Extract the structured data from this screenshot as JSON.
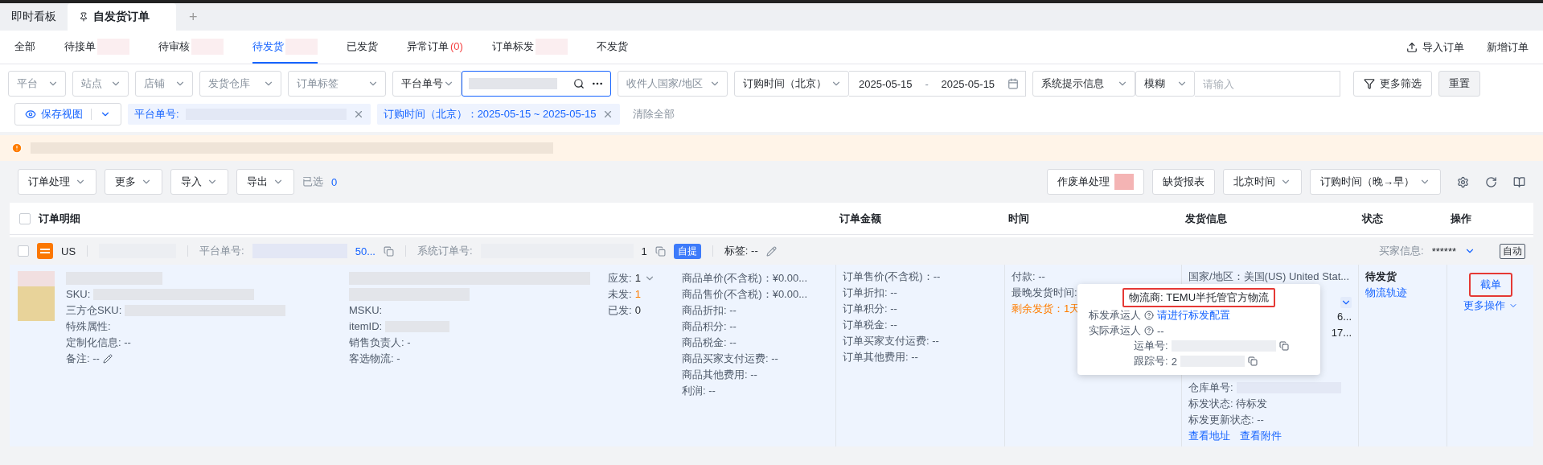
{
  "app_tabs": [
    {
      "label": "即时看板",
      "selected": false,
      "pinned": false
    },
    {
      "label": "自发货订单",
      "selected": true,
      "pinned": true
    }
  ],
  "add_tab": "+",
  "status_tabs": [
    {
      "label": "全部",
      "selected": false,
      "redacted": false
    },
    {
      "label": "待接单",
      "selected": false,
      "redacted": true
    },
    {
      "label": "待审核",
      "selected": false,
      "redacted": true
    },
    {
      "label": "待发货",
      "selected": true,
      "redacted": true
    },
    {
      "label": "已发货",
      "selected": false,
      "redacted": false
    },
    {
      "label": "异常订单",
      "count": "(0)",
      "selected": false,
      "redacted": false
    },
    {
      "label": "订单标发",
      "selected": false,
      "redacted": true
    },
    {
      "label": "不发货",
      "selected": false,
      "redacted": false
    }
  ],
  "header_actions": [
    {
      "kind": "import",
      "label": "导入订单"
    },
    {
      "kind": "plain",
      "label": "新增订单"
    }
  ],
  "filters": [
    {
      "kind": "select",
      "placeholder": "平台"
    },
    {
      "kind": "select",
      "placeholder": "站点"
    },
    {
      "kind": "select",
      "placeholder": "店铺"
    },
    {
      "kind": "select",
      "placeholder": "发货仓库"
    },
    {
      "kind": "select",
      "placeholder": "订单标签"
    },
    {
      "kind": "select",
      "value": "平台单号"
    },
    {
      "kind": "search",
      "redacted": true
    },
    {
      "kind": "select",
      "placeholder": "收件人国家/地区"
    },
    {
      "kind": "select",
      "value": "订购时间（北京）"
    },
    {
      "kind": "daterange",
      "start": "2025-05-15",
      "separator": "-",
      "end": "2025-05-15"
    },
    {
      "kind": "select",
      "value": "系统提示信息"
    },
    {
      "kind": "select",
      "value": "模糊"
    },
    {
      "kind": "input",
      "placeholder": "请输入"
    },
    {
      "kind": "button",
      "label": "更多筛选"
    },
    {
      "kind": "reset",
      "label": "重置"
    }
  ],
  "save_view": "保存视图",
  "chips": [
    {
      "label": "平台单号:",
      "redacted": true
    },
    {
      "label": "订购时间（北京）：2025-05-15 ~ 2025-05-15",
      "redacted": false
    }
  ],
  "clear_all": "清除全部",
  "toolbar_left": [
    {
      "label": "订单处理"
    },
    {
      "label": "更多"
    },
    {
      "label": "导入"
    },
    {
      "label": "导出"
    }
  ],
  "selected_label": "已选",
  "selected_count": "0",
  "toolbar_right": [
    {
      "label": "作废单处理",
      "dropdown": false,
      "badge": true
    },
    {
      "label": "缺货报表",
      "dropdown": false,
      "badge": false
    },
    {
      "label": "北京时间",
      "dropdown": true,
      "badge": false
    },
    {
      "label": "订购时间（晚→早）",
      "dropdown": true,
      "badge": false
    }
  ],
  "columns": [
    "订单明细",
    "订单金额",
    "时间",
    "发货信息",
    "状态",
    "操作"
  ],
  "select_all_checked": false,
  "order": {
    "checked": false,
    "site": "US",
    "platform_no_label": "平台单号:",
    "platform_no_tail": "50...",
    "system_no_label": "系统订单号:",
    "system_no_tail": "1",
    "pickup_tag": "自提",
    "tags": "标签: --",
    "buyer_label": "买家信息:",
    "buyer_value": "******",
    "auto": "自动",
    "sku_lines": [
      {
        "label": "SKU:",
        "redacted": true
      },
      {
        "label": "三方仓SKU:",
        "redacted": true
      },
      {
        "label": "特殊属性:",
        "redacted": false
      },
      {
        "label": "定制化信息: --",
        "redacted": false
      },
      {
        "label": "备注: --",
        "editable": true,
        "redacted": false
      }
    ],
    "item_lines": [
      {
        "label": "MSKU:",
        "redacted": false
      },
      {
        "label": "itemID:",
        "redacted": true
      },
      {
        "label": "销售负责人: -",
        "redacted": false
      },
      {
        "label": "客选物流: -",
        "redacted": false
      }
    ],
    "quantities": [
      {
        "label": "应发:",
        "value": "1",
        "highlight": false,
        "dropdown": true
      },
      {
        "label": "未发:",
        "value": "1",
        "highlight": true,
        "dropdown": false
      },
      {
        "label": "已发:",
        "value": "0",
        "highlight": false,
        "dropdown": false
      }
    ],
    "item_prices": [
      "商品单价(不含税)：¥0.00...",
      "商品售价(不含税)：¥0.00...",
      "商品折扣: --",
      "商品积分: --",
      "商品税金: --",
      "商品买家支付运费: --",
      "商品其他费用: --",
      "利润: --"
    ],
    "order_amounts": [
      "订单售价(不含税)：--",
      "订单折扣: --",
      "订单积分: --",
      "订单税金: --",
      "订单买家支付运费: --",
      "订单其他费用: --"
    ],
    "times": [
      {
        "text": "付款: --",
        "warning": false
      },
      {
        "text": "最晚发货时间:",
        "warning": false
      },
      {
        "text": "剩余发货：1天",
        "warning": true
      }
    ],
    "shipping_top": "国家/地区：美国(US) United Stat...",
    "shipping_fragments": [
      "6...",
      "17..."
    ],
    "warehouse_label": "仓库单号:",
    "shipping_lines": [
      "标发状态: 待标发",
      "标发更新状态: --"
    ],
    "shipping_links": [
      "查看地址",
      "查看附件"
    ],
    "status": "待发货",
    "status_link": "物流轨迹",
    "action_primary": "截单",
    "action_more": "更多操作"
  },
  "popover": {
    "carrier": "物流商: TEMU半托管官方物流",
    "label_carrier": "标发承运人",
    "label_carrier_link": "请进行标发配置",
    "actual_carrier": "实际承运人",
    "actual_carrier_value": "--",
    "waybill_label": "运单号:",
    "tracking_label": "跟踪号:",
    "tracking_head": "2"
  }
}
